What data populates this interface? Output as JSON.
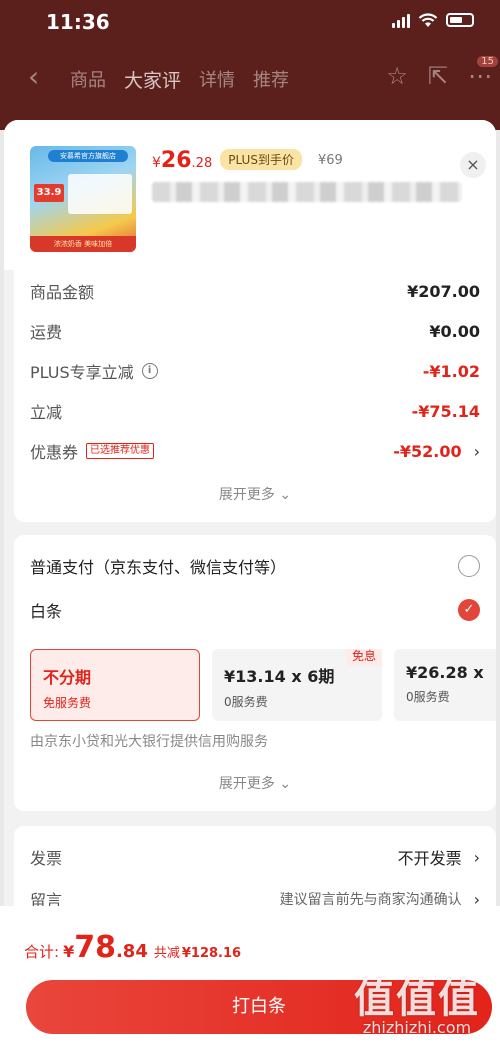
{
  "status_bar": {
    "time": "11:36"
  },
  "nav": {
    "back_icon": "chevron-left-icon",
    "tabs": [
      {
        "label": "商品"
      },
      {
        "label": "大家评"
      },
      {
        "label": "详情"
      },
      {
        "label": "推荐"
      }
    ],
    "cart_badge": "15"
  },
  "product": {
    "thumb_top_text": "安慕希官方旗舰店",
    "thumb_price": "33.9",
    "thumb_bottom_text": "浓浓奶香 美味加倍",
    "price_symbol": "¥",
    "price_int": "26",
    "price_dec": ".28",
    "plus_tag": "PLUS到手价",
    "original_price": "¥69",
    "close_icon": "×"
  },
  "summary": {
    "rows": [
      {
        "label": "商品金额",
        "value": "¥207.00"
      },
      {
        "label": "运费",
        "value": "¥0.00"
      },
      {
        "label": "PLUS专享立减",
        "value": "-¥1.02"
      },
      {
        "label": "立减",
        "value": "-¥75.14"
      },
      {
        "label": "优惠券",
        "tag": "已选推荐优惠",
        "value": "-¥52.00"
      }
    ],
    "expand_label": "展开更多 ⌄"
  },
  "payment": {
    "options": [
      {
        "label": "普通支付（京东支付、微信支付等）"
      },
      {
        "label": "白条"
      }
    ],
    "installments": [
      {
        "main": "不分期",
        "sub": "免服务费"
      },
      {
        "main": "¥13.14 x 6期",
        "sub": "0服务费",
        "badge": "免息"
      },
      {
        "main": "¥26.28 x",
        "sub": "0服务费"
      }
    ],
    "credit_note": "由京东小贷和光大银行提供信用购服务",
    "expand_label": "展开更多 ⌄"
  },
  "extra": {
    "invoice_label": "发票",
    "invoice_value": "不开发票",
    "message_label": "留言",
    "message_value": "建议留言前先与商家沟通确认"
  },
  "footer": {
    "total_label": "合计:",
    "total_symbol": "¥",
    "total_int": "78",
    "total_dec": ".84",
    "saved_label": "共减",
    "saved_value": "¥128.16",
    "pay_button": "打白条"
  },
  "watermark": {
    "chars": "值值值",
    "url": "zhizhizhi.com"
  },
  "colors": {
    "accent": "#e2231a",
    "plus_tag_bg": "#fbe3a6"
  }
}
